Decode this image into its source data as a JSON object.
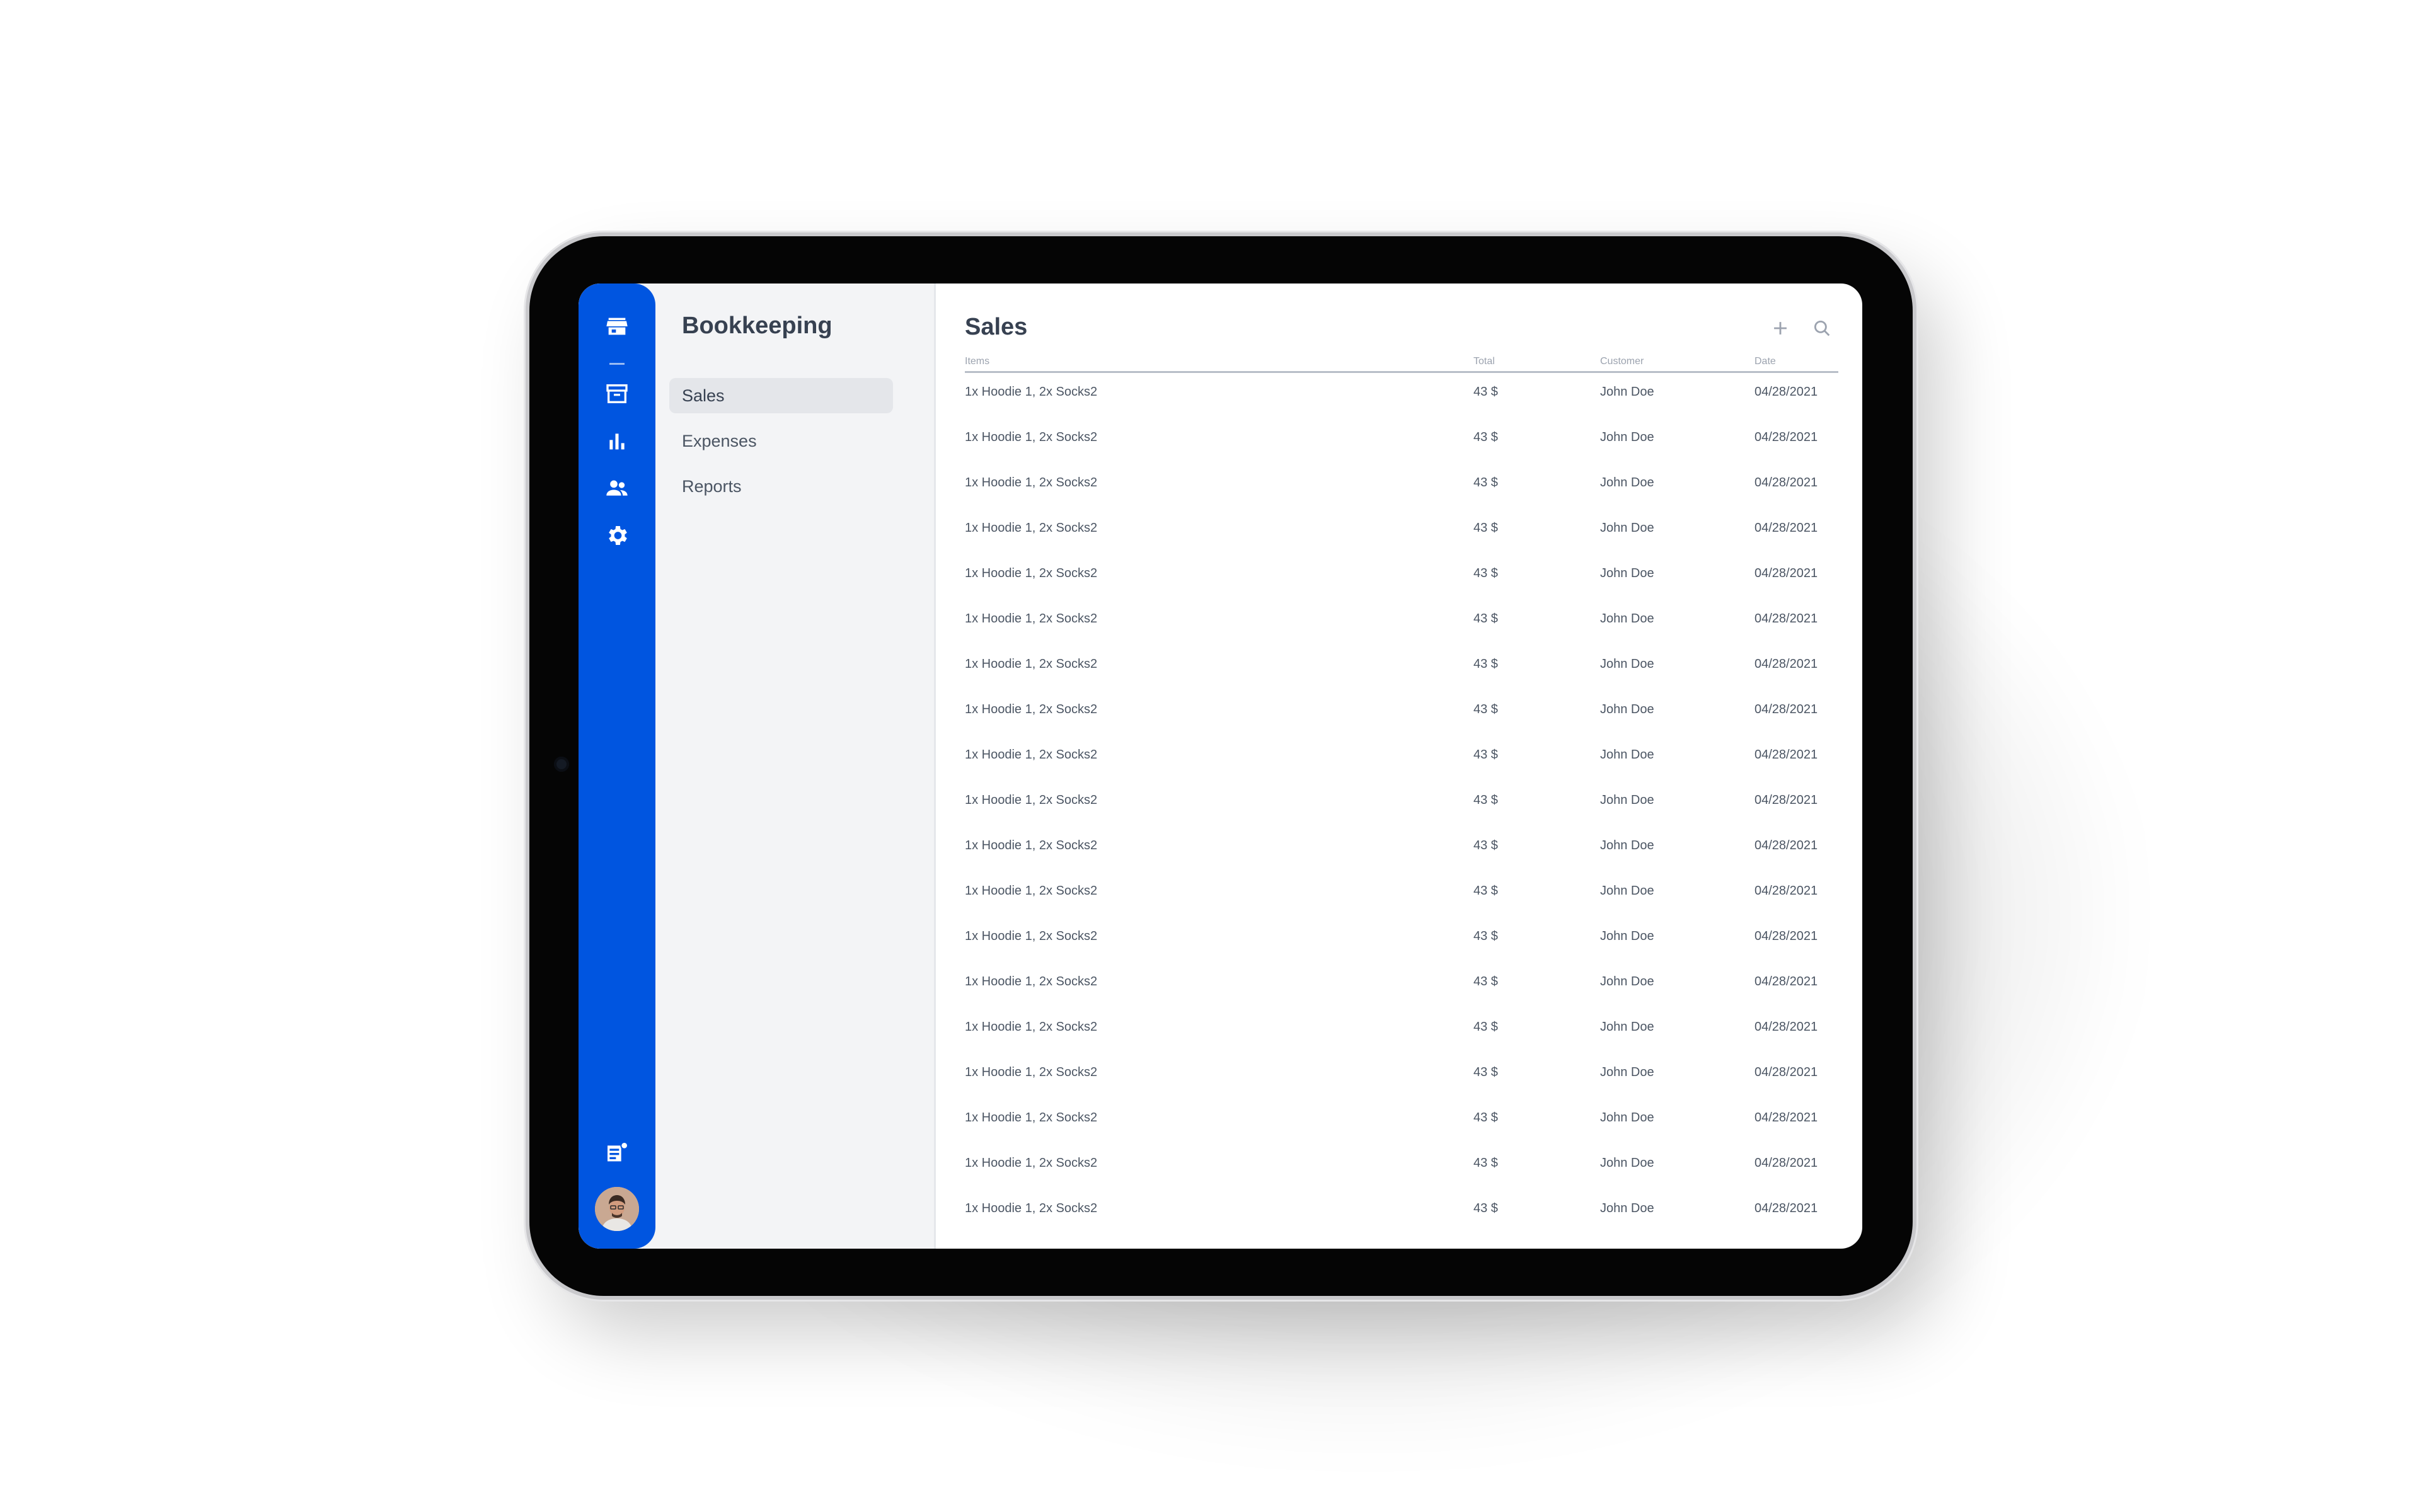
{
  "colors": {
    "rail": "#0055e0",
    "sidebar_bg": "#f3f4f6",
    "active_item_bg": "#e4e6ea",
    "text": "#374151"
  },
  "rail": {
    "icons": [
      "store-icon",
      "archive-icon",
      "bar-chart-icon",
      "users-icon",
      "settings-icon",
      "notes-icon"
    ]
  },
  "sidebar": {
    "title": "Bookkeeping",
    "items": [
      {
        "label": "Sales",
        "active": true
      },
      {
        "label": "Expenses",
        "active": false
      },
      {
        "label": "Reports",
        "active": false
      }
    ]
  },
  "main": {
    "title": "Sales",
    "actions": [
      "add-icon",
      "search-icon"
    ],
    "columns": [
      "Items",
      "Total",
      "Customer",
      "Date"
    ],
    "rows": [
      {
        "items": "1x Hoodie 1, 2x Socks2",
        "total": "43 $",
        "customer": "John Doe",
        "date": "04/28/2021"
      },
      {
        "items": "1x Hoodie 1, 2x Socks2",
        "total": "43 $",
        "customer": "John Doe",
        "date": "04/28/2021"
      },
      {
        "items": "1x Hoodie 1, 2x Socks2",
        "total": "43 $",
        "customer": "John Doe",
        "date": "04/28/2021"
      },
      {
        "items": "1x Hoodie 1, 2x Socks2",
        "total": "43 $",
        "customer": "John Doe",
        "date": "04/28/2021"
      },
      {
        "items": "1x Hoodie 1, 2x Socks2",
        "total": "43 $",
        "customer": "John Doe",
        "date": "04/28/2021"
      },
      {
        "items": "1x Hoodie 1, 2x Socks2",
        "total": "43 $",
        "customer": "John Doe",
        "date": "04/28/2021"
      },
      {
        "items": "1x Hoodie 1, 2x Socks2",
        "total": "43 $",
        "customer": "John Doe",
        "date": "04/28/2021"
      },
      {
        "items": "1x Hoodie 1, 2x Socks2",
        "total": "43 $",
        "customer": "John Doe",
        "date": "04/28/2021"
      },
      {
        "items": "1x Hoodie 1, 2x Socks2",
        "total": "43 $",
        "customer": "John Doe",
        "date": "04/28/2021"
      },
      {
        "items": "1x Hoodie 1, 2x Socks2",
        "total": "43 $",
        "customer": "John Doe",
        "date": "04/28/2021"
      },
      {
        "items": "1x Hoodie 1, 2x Socks2",
        "total": "43 $",
        "customer": "John Doe",
        "date": "04/28/2021"
      },
      {
        "items": "1x Hoodie 1, 2x Socks2",
        "total": "43 $",
        "customer": "John Doe",
        "date": "04/28/2021"
      },
      {
        "items": "1x Hoodie 1, 2x Socks2",
        "total": "43 $",
        "customer": "John Doe",
        "date": "04/28/2021"
      },
      {
        "items": "1x Hoodie 1, 2x Socks2",
        "total": "43 $",
        "customer": "John Doe",
        "date": "04/28/2021"
      },
      {
        "items": "1x Hoodie 1, 2x Socks2",
        "total": "43 $",
        "customer": "John Doe",
        "date": "04/28/2021"
      },
      {
        "items": "1x Hoodie 1, 2x Socks2",
        "total": "43 $",
        "customer": "John Doe",
        "date": "04/28/2021"
      },
      {
        "items": "1x Hoodie 1, 2x Socks2",
        "total": "43 $",
        "customer": "John Doe",
        "date": "04/28/2021"
      },
      {
        "items": "1x Hoodie 1, 2x Socks2",
        "total": "43 $",
        "customer": "John Doe",
        "date": "04/28/2021"
      },
      {
        "items": "1x Hoodie 1, 2x Socks2",
        "total": "43 $",
        "customer": "John Doe",
        "date": "04/28/2021"
      }
    ]
  }
}
